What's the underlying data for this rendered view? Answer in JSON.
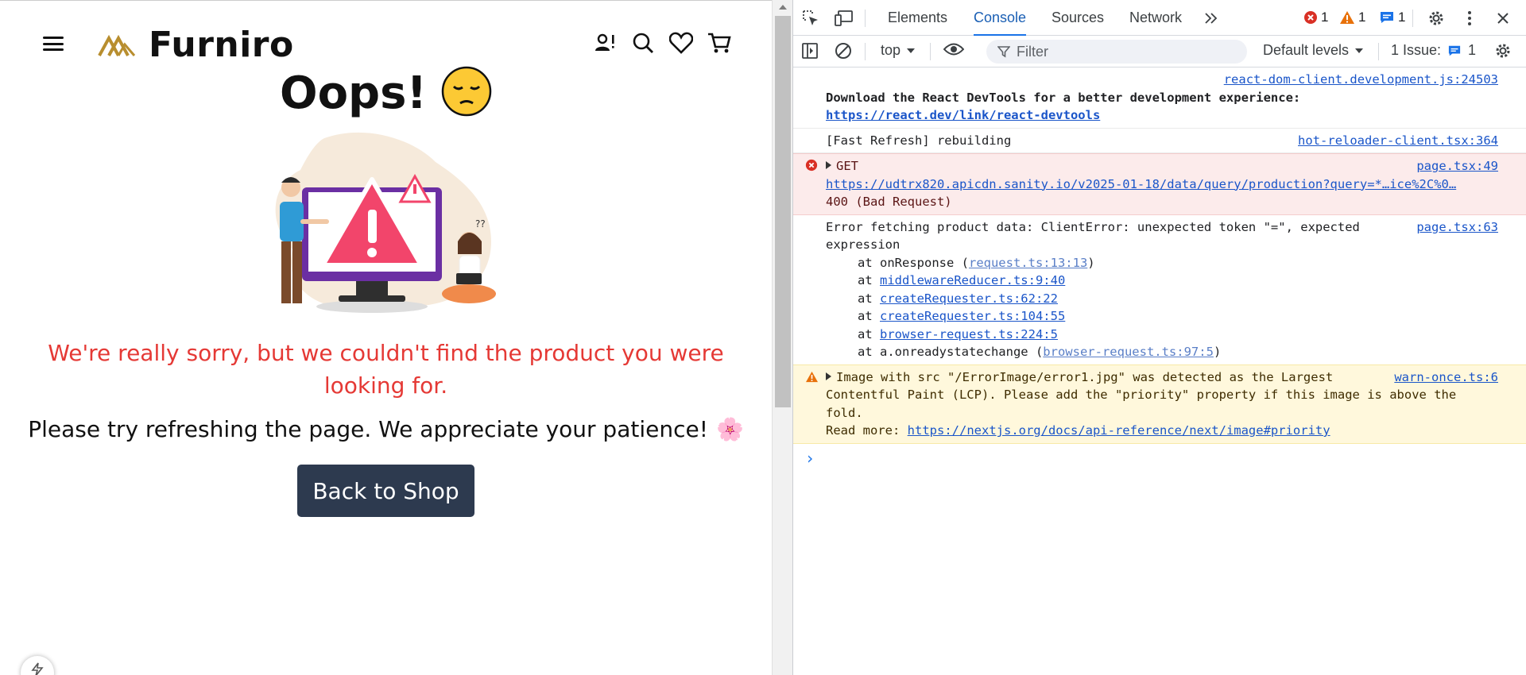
{
  "page": {
    "brand": "Furniro",
    "oops_title": "Oops!",
    "oops_emoji": "😔",
    "sorry_message": "We're really sorry, but we couldn't find the product you were looking for.",
    "refresh_message": "Please try refreshing the page. We appreciate your patience!",
    "refresh_emoji": "🌸",
    "back_button": "Back to Shop",
    "nav_icons": [
      "hamburger-menu-icon",
      "user-alert-icon",
      "search-icon",
      "heart-icon",
      "cart-icon"
    ],
    "colors": {
      "error_text": "#e53935",
      "button_bg": "#2d3a4f",
      "logo_gold": "#b88e2f"
    }
  },
  "devtools": {
    "tabs": [
      "Elements",
      "Console",
      "Sources",
      "Network"
    ],
    "active_tab": "Console",
    "counts": {
      "errors": "1",
      "warnings": "1",
      "info": "1"
    },
    "context": "top",
    "filter_placeholder": "Filter",
    "levels": "Default levels",
    "issues_label": "1 Issue:",
    "issues_count": "1",
    "messages": {
      "devtools_src": "react-dom-client.development.js:24503",
      "devtools_text": "Download the React DevTools for a better development experience:",
      "devtools_link": "https://react.dev/link/react-devtools",
      "fast_refresh": "[Fast Refresh] rebuilding",
      "fast_refresh_src": "hot-reloader-client.tsx:364",
      "get_label": "GET",
      "get_src": "page.tsx:49",
      "get_url": "https://udtrx820.apicdn.sanity.io/v2025-01-18/data/query/production?query=*…ice%2C%0…",
      "get_status": "400 (Bad Request)",
      "client_error": "Error fetching product data: ClientError: unexpected token \"=\", expected",
      "client_error_2": "expression",
      "client_error_src": "page.tsx:63",
      "stack": [
        {
          "prefix": "at onResponse (",
          "link": "request.ts:13:13",
          "suffix": ")",
          "dim": true
        },
        {
          "prefix": "at ",
          "link": "middlewareReducer.ts:9:40",
          "suffix": "",
          "dim": false
        },
        {
          "prefix": "at ",
          "link": "createRequester.ts:62:22",
          "suffix": "",
          "dim": false
        },
        {
          "prefix": "at ",
          "link": "createRequester.ts:104:55",
          "suffix": "",
          "dim": false
        },
        {
          "prefix": "at ",
          "link": "browser-request.ts:224:5",
          "suffix": "",
          "dim": false
        },
        {
          "prefix": "at a.onreadystatechange (",
          "link": "browser-request.ts:97:5",
          "suffix": ")",
          "dim": true
        }
      ],
      "warn_text_1": "Image with src \"/ErrorImage/error1.jpg\" was detected as the Largest",
      "warn_text_2": "Contentful Paint (LCP). Please add the \"priority\" property if this image is above the",
      "warn_text_3": "fold.",
      "warn_src": "warn-once.ts:6",
      "warn_readmore": "Read more:",
      "warn_link": "https://nextjs.org/docs/api-reference/next/image#priority",
      "prompt": "›"
    }
  }
}
